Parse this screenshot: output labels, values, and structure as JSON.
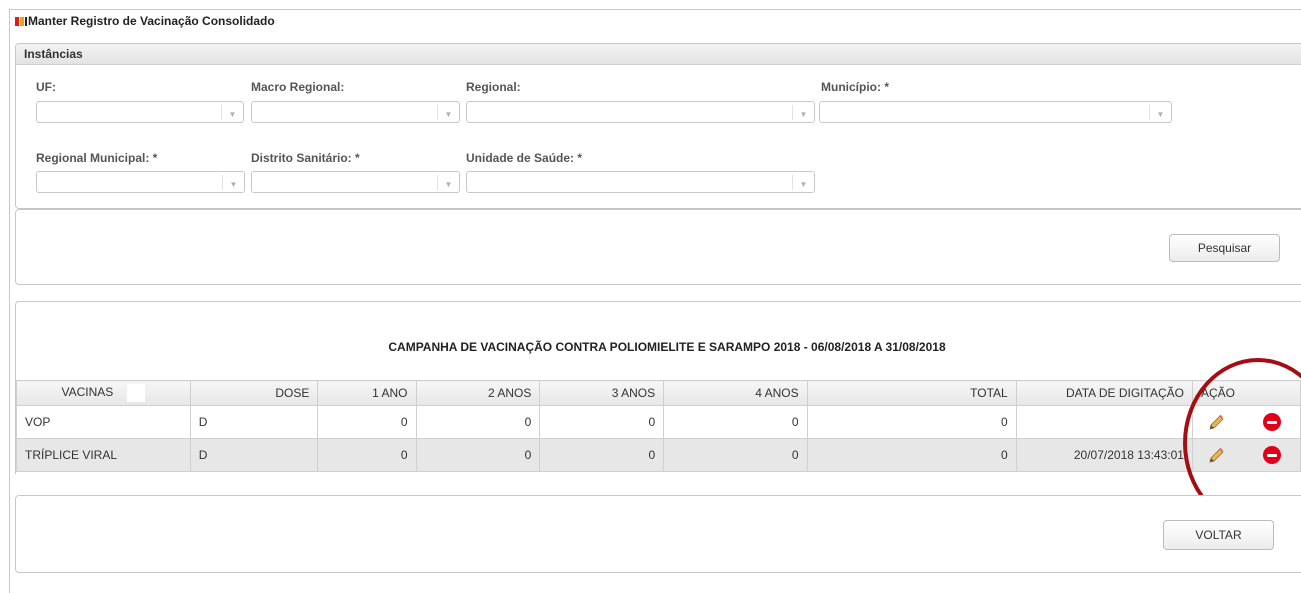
{
  "page": {
    "title": "Manter Registro de Vacinação Consolidado"
  },
  "instancias": {
    "header": "Instâncias",
    "fields": {
      "uf": {
        "label": "UF:",
        "value": ""
      },
      "macro_regional": {
        "label": "Macro Regional:",
        "value": ""
      },
      "regional": {
        "label": "Regional:",
        "value": ""
      },
      "municipio": {
        "label": "Município: *",
        "value": ""
      },
      "regional_municipal": {
        "label": "Regional Municipal: *",
        "value": ""
      },
      "distrito_sanitario": {
        "label": "Distrito Sanitário: *",
        "value": ""
      },
      "unidade_saude": {
        "label": "Unidade de Saúde: *",
        "value": ""
      }
    }
  },
  "search": {
    "button_label": "Pesquisar"
  },
  "results": {
    "campaign_title": "CAMPANHA DE VACINAÇÃO CONTRA POLIOMIELITE E SARAMPO 2018 - 06/08/2018 A 31/08/2018",
    "columns": [
      "VACINAS",
      "DOSE",
      "1 ANO",
      "2 ANOS",
      "3 ANOS",
      "4 ANOS",
      "TOTAL",
      "DATA DE DIGITAÇÃO",
      "AÇÃO"
    ],
    "rows": [
      {
        "vacina": "VOP",
        "dose": "D",
        "ano1": "0",
        "ano2": "0",
        "ano3": "0",
        "ano4": "0",
        "total": "0",
        "data": ""
      },
      {
        "vacina": "TRÍPLICE VIRAL",
        "dose": "D",
        "ano1": "0",
        "ano2": "0",
        "ano3": "0",
        "ano4": "0",
        "total": "0",
        "data": "20/07/2018 13:43:01"
      }
    ],
    "actions": {
      "edit_icon": "pencil-icon",
      "remove_icon": "remove-icon"
    }
  },
  "footer": {
    "back_label": "VOLTAR"
  },
  "colors": {
    "highlight_ring": "#a40d12",
    "remove_red": "#e0001a",
    "alt_row": "#e7e7e7"
  }
}
